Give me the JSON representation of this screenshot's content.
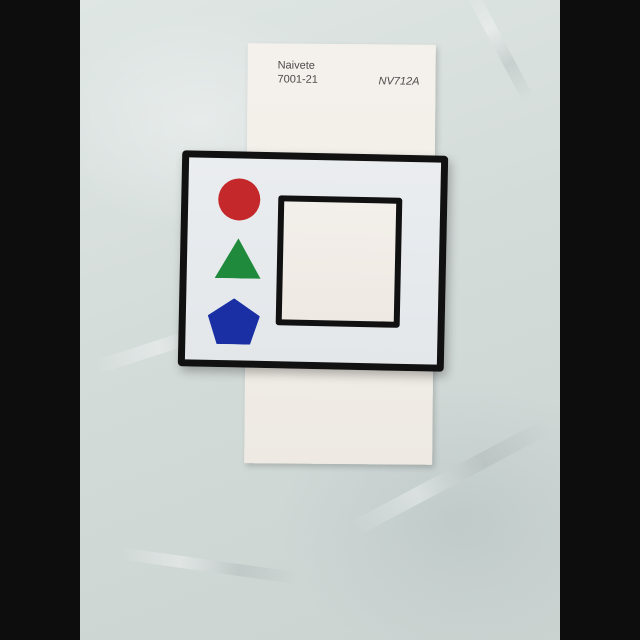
{
  "image": {
    "description_kind": "photo",
    "background": "light grey fabric",
    "colors": {
      "circle": "#c4282a",
      "triangle": "#1f8a3b",
      "pentagon": "#1a2fa3",
      "frame_border": "#111111",
      "swatch_card": "#f2eee8"
    }
  },
  "paint_swatch": {
    "name": "Naivete",
    "number": "7001-21",
    "code": "NV712A"
  },
  "shape_card": {
    "shapes": [
      {
        "kind": "circle",
        "color": "red"
      },
      {
        "kind": "triangle",
        "color": "green"
      },
      {
        "kind": "pentagon",
        "color": "blue"
      }
    ]
  }
}
